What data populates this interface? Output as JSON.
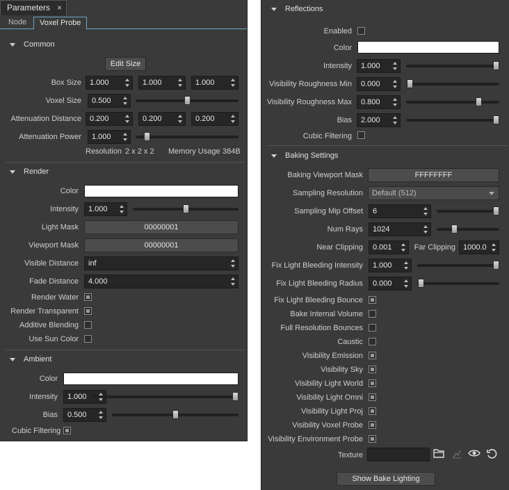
{
  "window": {
    "tab_title": "Parameters",
    "close": "×"
  },
  "tabs": [
    {
      "label": "Node"
    },
    {
      "label": "Voxel Probe"
    }
  ],
  "common": {
    "title": "Common",
    "edit_size": "Edit Size",
    "box_size_label": "Box Size",
    "box_size": [
      "1.000",
      "1.000",
      "1.000"
    ],
    "voxel_size_label": "Voxel Size",
    "voxel_size": "0.500",
    "voxel_size_slider": 0.5,
    "attenuation_distance_label": "Attenuation Distance",
    "attenuation_distance": [
      "0.200",
      "0.200",
      "0.200"
    ],
    "attenuation_power_label": "Attenuation Power",
    "attenuation_power": "1.000",
    "attenuation_power_slider": 0.08,
    "resolution_label": "Resolution",
    "resolution_value": "2  x  2  x  2",
    "memory_label": "Memory Usage",
    "memory_value": "384B"
  },
  "render": {
    "title": "Render",
    "color_label": "Color",
    "color": "#ffffff",
    "intensity_label": "Intensity",
    "intensity": "1.000",
    "intensity_slider": 0.5,
    "light_mask_label": "Light Mask",
    "light_mask": "00000001",
    "viewport_mask_label": "Viewport Mask",
    "viewport_mask": "00000001",
    "visible_distance_label": "Visible Distance",
    "visible_distance": "inf",
    "fade_distance_label": "Fade Distance",
    "fade_distance": "4.000",
    "render_water_label": "Render Water",
    "render_water": true,
    "render_transparent_label": "Render Transparent",
    "render_transparent": true,
    "additive_blending_label": "Additive Blending",
    "additive_blending": false,
    "use_sun_color_label": "Use Sun Color",
    "use_sun_color": false
  },
  "ambient": {
    "title": "Ambient",
    "color_label": "Color",
    "color": "#ffffff",
    "intensity_label": "Intensity",
    "intensity": "1.000",
    "intensity_slider": 1.0,
    "bias_label": "Bias",
    "bias": "0.500",
    "bias_slider": 0.5,
    "cubic_filtering_label": "Cubic Filtering",
    "cubic_filtering": true
  },
  "reflections": {
    "title": "Reflections",
    "enabled_label": "Enabled",
    "enabled": false,
    "color_label": "Color",
    "color": "#ffffff",
    "intensity_label": "Intensity",
    "intensity": "1.000",
    "intensity_slider": 1.0,
    "vis_rough_min_label": "Visibility Roughness Min",
    "vis_rough_min": "0.000",
    "vis_rough_min_slider": 0.0,
    "vis_rough_max_label": "Visibility Roughness Max",
    "vis_rough_max": "0.800",
    "vis_rough_max_slider": 0.8,
    "bias_label": "Bias",
    "bias": "2.000",
    "bias_slider": 1.0,
    "cubic_filtering_label": "Cubic Filtering",
    "cubic_filtering": false
  },
  "baking": {
    "title": "Baking Settings",
    "viewport_mask_label": "Baking Viewport Mask",
    "viewport_mask": "FFFFFFFF",
    "sampling_resolution_label": "Sampling Resolution",
    "sampling_resolution": "Default (512)",
    "sampling_mip_offset_label": "Sampling Mip Offset",
    "sampling_mip_offset": "6",
    "sampling_mip_offset_slider": 1.0,
    "num_rays_label": "Num Rays",
    "num_rays": "1024",
    "num_rays_slider": 0.25,
    "near_clipping_label": "Near Clipping",
    "near_clipping": "0.001",
    "far_clipping_label": "Far Clipping",
    "far_clipping": "1000.0",
    "fix_bleed_intensity_label": "Fix Light Bleeding Intensity",
    "fix_bleed_intensity": "1.000",
    "fix_bleed_intensity_slider": 1.0,
    "fix_bleed_radius_label": "Fix Light Bleeding Radius",
    "fix_bleed_radius": "0.000",
    "fix_bleed_radius_slider": 0.0,
    "checks": [
      {
        "label": "Fix Light Bleeding Bounce",
        "checked": true
      },
      {
        "label": "Bake Internal Volume",
        "checked": false
      },
      {
        "label": "Full Resolution Bounces",
        "checked": false
      },
      {
        "label": "Caustic",
        "checked": false
      },
      {
        "label": "Visibility Emission",
        "checked": true
      },
      {
        "label": "Visibility Sky",
        "checked": true
      },
      {
        "label": "Visibility Light World",
        "checked": true
      },
      {
        "label": "Visibility Light Omni",
        "checked": true
      },
      {
        "label": "Visibility Light Proj",
        "checked": true
      },
      {
        "label": "Visibility Voxel Probe",
        "checked": true
      },
      {
        "label": "Visibility Environment Probe",
        "checked": true
      }
    ],
    "texture_label": "Texture",
    "texture_value": "",
    "texture_icons": [
      "folder-icon",
      "unlink-icon",
      "eye-icon",
      "reset-icon"
    ],
    "show_bake_lighting": "Show Bake Lighting"
  }
}
